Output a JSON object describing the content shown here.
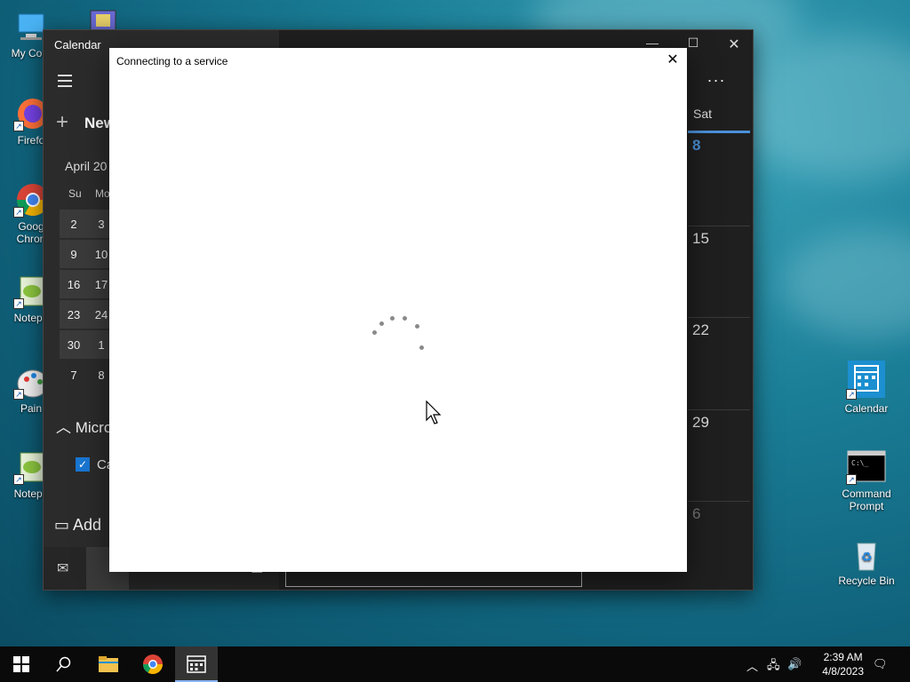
{
  "desktop": {
    "icons_left": [
      {
        "label": "My Com",
        "icon": "computer-icon"
      },
      {
        "label": "Firefo",
        "icon": "firefox-icon"
      },
      {
        "label": "Goog\nChron",
        "icon": "chrome-icon"
      },
      {
        "label": "Notepa",
        "icon": "notepad-icon"
      },
      {
        "label": "Pain",
        "icon": "paint-icon"
      },
      {
        "label": "Notepa",
        "icon": "notepad-icon"
      }
    ],
    "icons_right": [
      {
        "label": "Calendar",
        "icon": "calendar-icon"
      },
      {
        "label": "Command Prompt",
        "icon": "cmd-icon"
      },
      {
        "label": "Recycle Bin",
        "icon": "recycle-bin-icon"
      }
    ]
  },
  "calendar_window": {
    "title": "Calendar",
    "new_event_label": "New",
    "month_label": "April 20",
    "weekdays": [
      "Su",
      "Mo"
    ],
    "weeks": [
      [
        "2",
        "3"
      ],
      [
        "9",
        "10"
      ],
      [
        "16",
        "17"
      ],
      [
        "23",
        "24"
      ],
      [
        "30",
        "1"
      ],
      [
        "7",
        "8"
      ]
    ],
    "account_section": "Micro",
    "calendar_checkbox_label": "Ca",
    "add_calendar_label": "Add",
    "saturday_header": "Sat",
    "saturday_dates": [
      "8",
      "15",
      "22",
      "29",
      "6"
    ],
    "more_label": "...",
    "accent": "#4a90d9"
  },
  "dialog": {
    "title": "Connecting to a service",
    "close_label": "✕"
  },
  "taskbar": {
    "time": "2:39 AM",
    "date": "4/8/2023"
  }
}
